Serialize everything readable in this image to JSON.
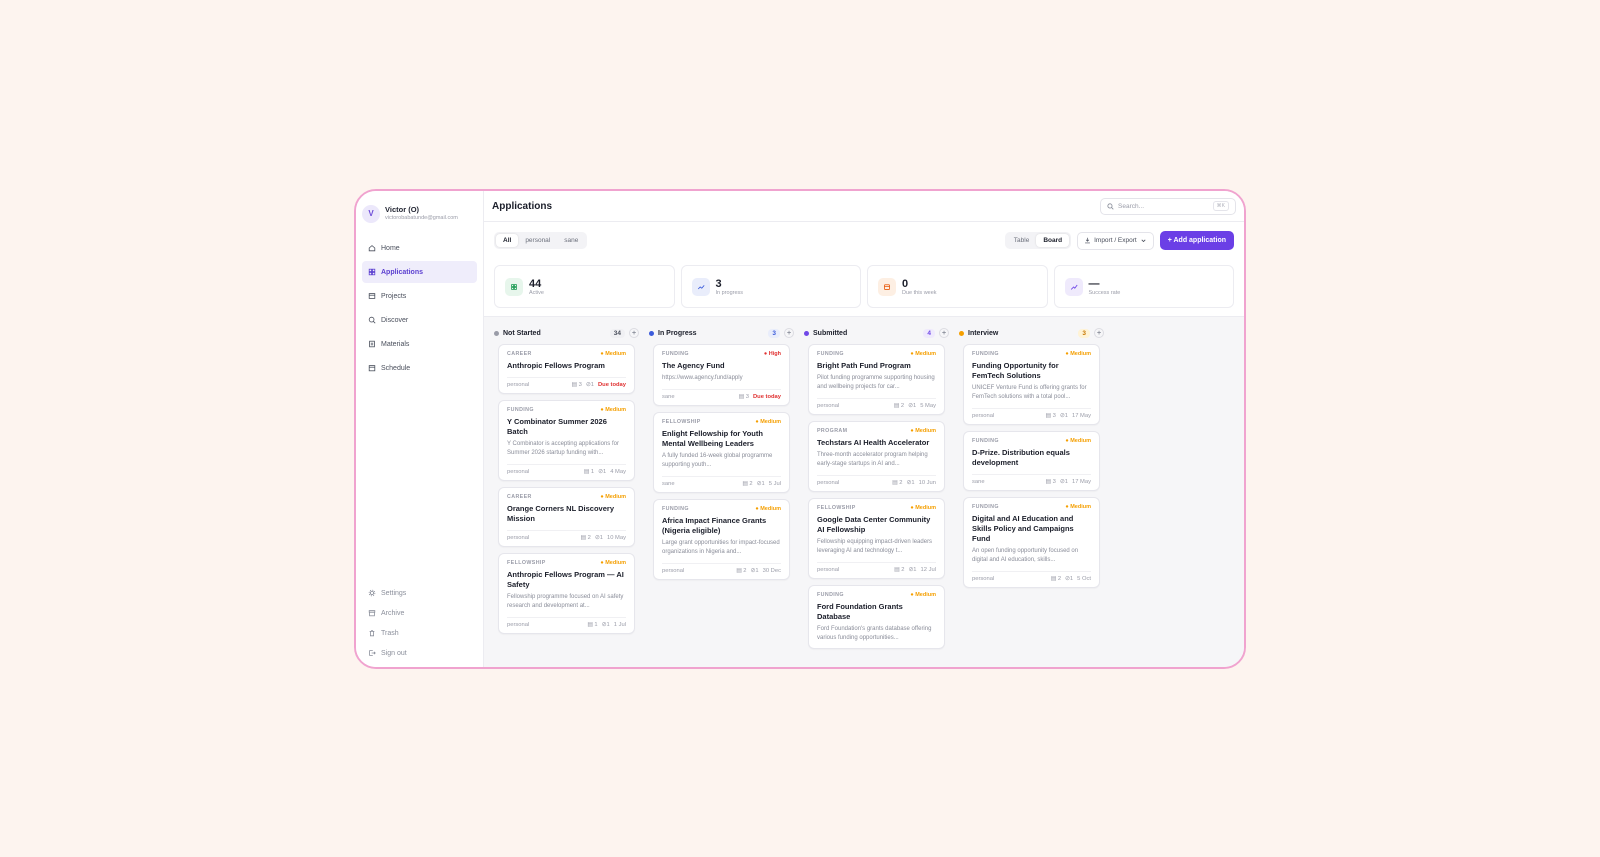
{
  "user": {
    "initial": "V",
    "name": "Victor (O)",
    "email": "victorobabatunde@gmail.com"
  },
  "nav": [
    {
      "label": "Home",
      "icon": "home-icon"
    },
    {
      "label": "Applications",
      "icon": "grid-icon",
      "active": true
    },
    {
      "label": "Projects",
      "icon": "folder-icon"
    },
    {
      "label": "Discover",
      "icon": "compass-icon"
    },
    {
      "label": "Materials",
      "icon": "file-icon"
    },
    {
      "label": "Schedule",
      "icon": "calendar-icon"
    }
  ],
  "nav_bottom": [
    {
      "label": "Settings",
      "icon": "gear-icon"
    },
    {
      "label": "Archive",
      "icon": "archive-icon"
    },
    {
      "label": "Trash",
      "icon": "trash-icon"
    },
    {
      "label": "Sign out",
      "icon": "signout-icon"
    }
  ],
  "header": {
    "title": "Applications",
    "search_placeholder": "Search...",
    "shortcut": "⌘K"
  },
  "filters": [
    "All",
    "personal",
    "sane"
  ],
  "views": [
    "Table",
    "Board"
  ],
  "import_export": "Import / Export",
  "add_button": "+ Add application",
  "stats": [
    {
      "value": "44",
      "label": "Active",
      "color": "#1f9d55",
      "bg": "#e7f6ec"
    },
    {
      "value": "3",
      "label": "In progress",
      "color": "#3b5bdb",
      "bg": "#e9edfb"
    },
    {
      "value": "0",
      "label": "Due this week",
      "color": "#e8590c",
      "bg": "#fdefe3"
    },
    {
      "value": "—",
      "label": "Success rate",
      "color": "#7048e8",
      "bg": "#efeafc"
    }
  ],
  "columns": [
    {
      "name": "Not Started",
      "count": "34",
      "color": "#9a9ca8",
      "badge_bg": "#f0f0f3",
      "badge_fg": "#4a4f5c",
      "cards": [
        {
          "cat": "CAREER",
          "pri": "Medium",
          "title": "Anthropic Fellows Program",
          "desc": "",
          "tag": "personal",
          "m1": "3",
          "m2": "1",
          "date": "Due today",
          "due": true
        },
        {
          "cat": "FUNDING",
          "pri": "Medium",
          "title": "Y Combinator Summer 2026 Batch",
          "desc": "Y Combinator is accepting applications for Summer 2026 startup funding with...",
          "tag": "personal",
          "m1": "1",
          "m2": "1",
          "date": "4 May"
        },
        {
          "cat": "CAREER",
          "pri": "Medium",
          "title": "Orange Corners NL Discovery Mission",
          "desc": "",
          "tag": "personal",
          "m1": "2",
          "m2": "1",
          "date": "10 May"
        },
        {
          "cat": "FELLOWSHIP",
          "pri": "Medium",
          "title": "Anthropic Fellows Program — AI Safety",
          "desc": "Fellowship programme focused on AI safety research and development at...",
          "tag": "personal",
          "m1": "1",
          "m2": "1",
          "date": "1 Jul"
        }
      ]
    },
    {
      "name": "In Progress",
      "count": "3",
      "color": "#3b5bdb",
      "badge_bg": "#e9edfb",
      "badge_fg": "#3b5bdb",
      "cards": [
        {
          "cat": "FUNDING",
          "pri": "High",
          "title": "The Agency Fund",
          "desc": "https://www.agency.fund/apply",
          "tag": "sane",
          "m1": "3",
          "m2": "",
          "date": "Due today",
          "due": true
        },
        {
          "cat": "FELLOWSHIP",
          "pri": "Medium",
          "title": "Enlight Fellowship for Youth Mental Wellbeing Leaders",
          "desc": "A fully funded 16-week global programme supporting youth...",
          "tag": "sane",
          "m1": "2",
          "m2": "1",
          "date": "5 Jul"
        },
        {
          "cat": "FUNDING",
          "pri": "Medium",
          "title": "Africa Impact Finance Grants (Nigeria eligible)",
          "desc": "Large grant opportunities for impact-focused organizations in Nigeria and...",
          "tag": "personal",
          "m1": "2",
          "m2": "1",
          "date": "30 Dec"
        }
      ]
    },
    {
      "name": "Submitted",
      "count": "4",
      "color": "#7048e8",
      "badge_bg": "#efeafc",
      "badge_fg": "#7048e8",
      "cards": [
        {
          "cat": "FUNDING",
          "pri": "Medium",
          "title": "Bright Path Fund Program",
          "desc": "Pilot funding programme supporting housing and wellbeing projects for car...",
          "tag": "personal",
          "m1": "2",
          "m2": "1",
          "date": "5 May"
        },
        {
          "cat": "PROGRAM",
          "pri": "Medium",
          "title": "Techstars AI Health Accelerator",
          "desc": "Three-month accelerator program helping early-stage startups in AI and...",
          "tag": "personal",
          "m1": "2",
          "m2": "1",
          "date": "10 Jun"
        },
        {
          "cat": "FELLOWSHIP",
          "pri": "Medium",
          "title": "Google Data Center Community AI Fellowship",
          "desc": "Fellowship equipping impact-driven leaders leveraging AI and technology t...",
          "tag": "personal",
          "m1": "2",
          "m2": "1",
          "date": "12 Jul"
        },
        {
          "cat": "FUNDING",
          "pri": "Medium",
          "title": "Ford Foundation Grants Database",
          "desc": "Ford Foundation's grants database offering various funding opportunities...",
          "tag": "",
          "m1": "",
          "m2": "",
          "date": ""
        }
      ]
    },
    {
      "name": "Interview",
      "count": "3",
      "color": "#f59f00",
      "badge_bg": "#fff3d6",
      "badge_fg": "#c77700",
      "cards": [
        {
          "cat": "FUNDING",
          "pri": "Medium",
          "title": "Funding Opportunity for FemTech Solutions",
          "desc": "UNICEF Venture Fund is offering grants for FemTech solutions with a total pool...",
          "tag": "personal",
          "m1": "3",
          "m2": "1",
          "date": "17 May"
        },
        {
          "cat": "FUNDING",
          "pri": "Medium",
          "title": "D-Prize. Distribution equals development",
          "desc": "",
          "tag": "sane",
          "m1": "3",
          "m2": "1",
          "date": "17 May"
        },
        {
          "cat": "FUNDING",
          "pri": "Medium",
          "title": "Digital and AI Education and Skills Policy and Campaigns Fund",
          "desc": "An open funding opportunity focused on digital and AI education, skills...",
          "tag": "personal",
          "m1": "2",
          "m2": "1",
          "date": "5 Oct"
        }
      ]
    }
  ],
  "colors": {
    "accent": "#6b3fe6",
    "medium": "#f59f00",
    "high": "#e03131",
    "due": "#e03131",
    "frame": "#f0a3cf"
  }
}
